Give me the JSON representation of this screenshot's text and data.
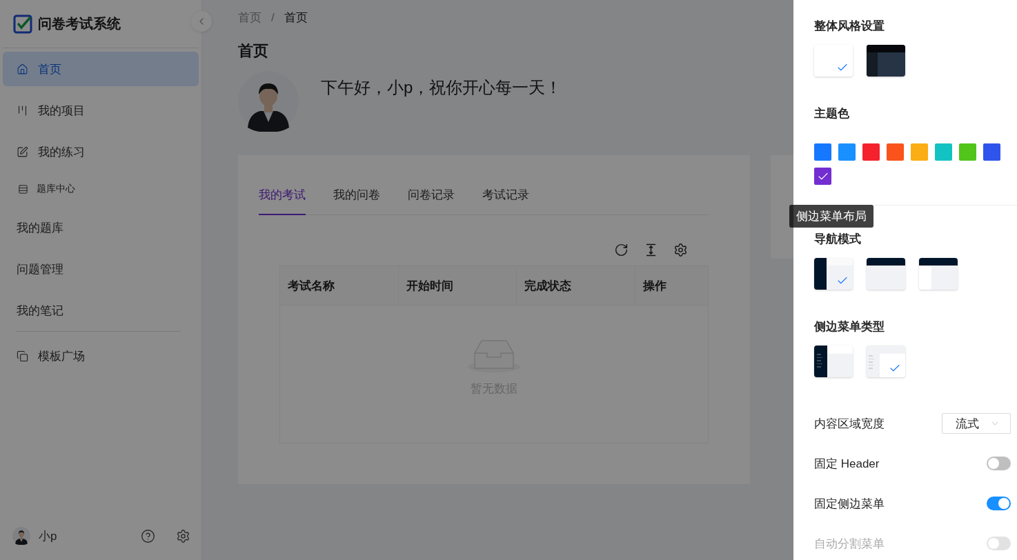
{
  "app": {
    "title": "问卷考试系统"
  },
  "sidebar": {
    "items": [
      {
        "kind": "item",
        "label": "首页",
        "selected": true
      },
      {
        "kind": "item",
        "label": "我的项目",
        "selected": false
      },
      {
        "kind": "item",
        "label": "我的练习",
        "selected": false
      },
      {
        "kind": "group",
        "label": "题库中心"
      },
      {
        "kind": "subitem",
        "label": "我的题库",
        "selected": false
      },
      {
        "kind": "subitem",
        "label": "问题管理",
        "selected": false
      },
      {
        "kind": "subitem",
        "label": "我的笔记",
        "selected": false
      },
      {
        "kind": "divider"
      },
      {
        "kind": "item",
        "label": "模板广场",
        "selected": false
      }
    ],
    "user": {
      "name": "小p"
    }
  },
  "breadcrumb": [
    "首页",
    "首页"
  ],
  "breadcrumb_separator": "/",
  "page_title": "首页",
  "greeting": "下午好，小p，祝你开心每一天！",
  "tabs": [
    {
      "label": "我的考试",
      "selected": true
    },
    {
      "label": "我的问卷",
      "selected": false
    },
    {
      "label": "问卷记录",
      "selected": false
    },
    {
      "label": "考试记录",
      "selected": false
    }
  ],
  "table": {
    "columns": [
      "考试名称",
      "开始时间",
      "完成状态",
      "操作"
    ],
    "empty_text": "暂无数据"
  },
  "settings": {
    "style_title": "整体风格设置",
    "styles": [
      {
        "kind": "light",
        "selected": true
      },
      {
        "kind": "dark",
        "selected": false
      }
    ],
    "theme_title": "主题色",
    "theme_colors": [
      {
        "color": "#1677ff",
        "selected": false
      },
      {
        "color": "#1890ff",
        "selected": false
      },
      {
        "color": "#f5222d",
        "selected": false
      },
      {
        "color": "#fa541c",
        "selected": false
      },
      {
        "color": "#faad14",
        "selected": false
      },
      {
        "color": "#13c2c2",
        "selected": false
      },
      {
        "color": "#52c41a",
        "selected": false
      },
      {
        "color": "#2f54eb",
        "selected": false
      },
      {
        "color": "#722ed1",
        "selected": true
      }
    ],
    "nav_title": "导航模式",
    "tooltip": "侧边菜单布局",
    "nav_modes": [
      {
        "kind": "side",
        "selected": true
      },
      {
        "kind": "top",
        "selected": false
      },
      {
        "kind": "mix",
        "selected": false
      }
    ],
    "menu_type_title": "侧边菜单类型",
    "menu_types": [
      {
        "kind": "dark",
        "selected": false
      },
      {
        "kind": "light",
        "selected": true
      }
    ],
    "width": {
      "label": "内容区域宽度",
      "value": "流式"
    },
    "switches": [
      {
        "label": "固定 Header",
        "on": false,
        "disabled": false
      },
      {
        "label": "固定侧边菜单",
        "on": true,
        "disabled": false
      },
      {
        "label": "自动分割菜单",
        "on": false,
        "disabled": true
      }
    ]
  }
}
